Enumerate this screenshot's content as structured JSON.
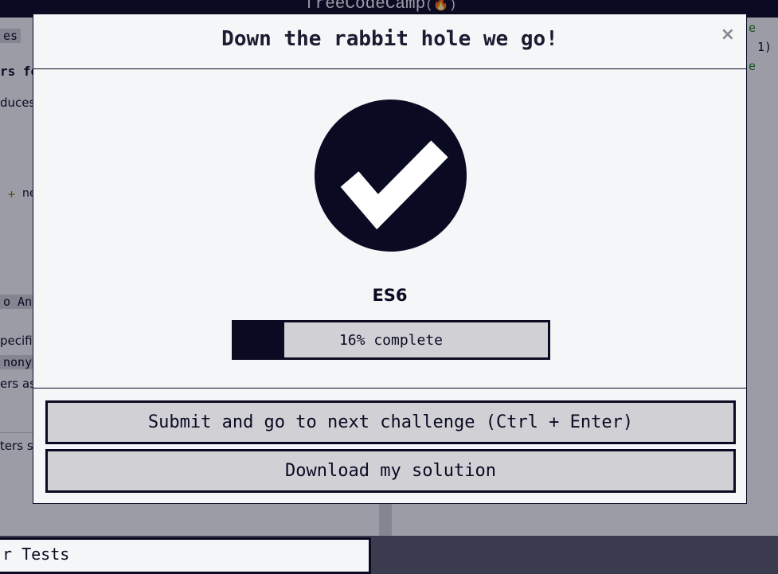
{
  "background": {
    "brand": "freeCodeCamp",
    "brand_logo_glyph": "(🔥)",
    "fragments": {
      "tab": "es",
      "heading": "rs fo",
      "line1": "duces",
      "plus": "+",
      "code": "ne",
      "section": "o An",
      "spec": "pecifie",
      "anon": "nonym",
      "params": "ers as",
      "params2": "ters s",
      "tests": "r Tests",
      "code_right_1": "e",
      "code_right_2": "1)",
      "code_right_3": "e"
    }
  },
  "modal": {
    "title": "Down the rabbit hole we go!",
    "close_label": "×",
    "check_icon": "check-circle-icon",
    "block_name": "ES6",
    "progress": {
      "percent": 16,
      "label": "16% complete"
    },
    "buttons": {
      "submit": "Submit and go to next challenge (Ctrl + Enter)",
      "download": "Download my solution"
    }
  },
  "colors": {
    "primary": "#0a0a23",
    "surface": "#f5f6f7",
    "button_bg": "#d0d0d5"
  }
}
